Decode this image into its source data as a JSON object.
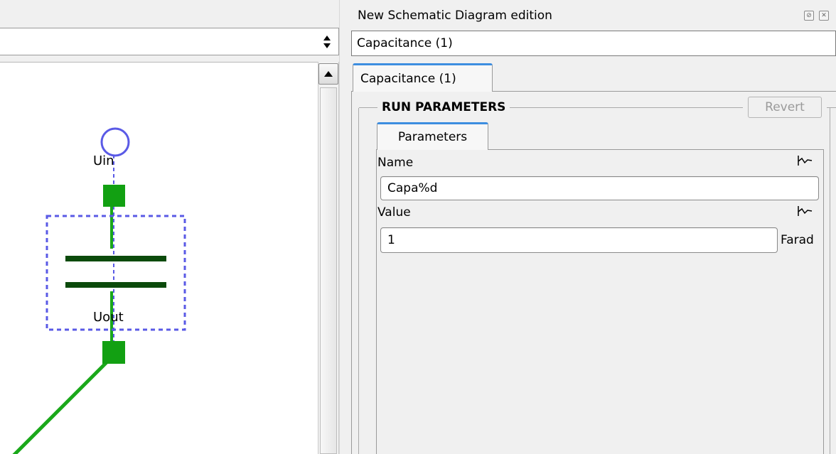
{
  "dock": {
    "title": "New Schematic Diagram edition",
    "float_icon": "float-icon",
    "close_icon": "close-icon"
  },
  "editor": {
    "current_item": "Capacitance (1)"
  },
  "tabs": {
    "outer": "Capacitance (1)",
    "inner": "Parameters"
  },
  "run_parameters": {
    "title": "RUN PARAMETERS",
    "revert_label": "Revert"
  },
  "parameters": {
    "name_label": "Name",
    "name_value": "Capa%d",
    "value_label": "Value",
    "value_value": "1",
    "value_unit": "Farad",
    "curve_icon": "curve-icon"
  },
  "schematic": {
    "port_in": "Uin",
    "port_out": "Uout",
    "component_icon": "capacitor-icon"
  },
  "colors": {
    "wire": "#1aa81a",
    "plate": "#0b4a0b",
    "selection": "#5a5ae6",
    "tab_accent": "#3d8ee0"
  }
}
